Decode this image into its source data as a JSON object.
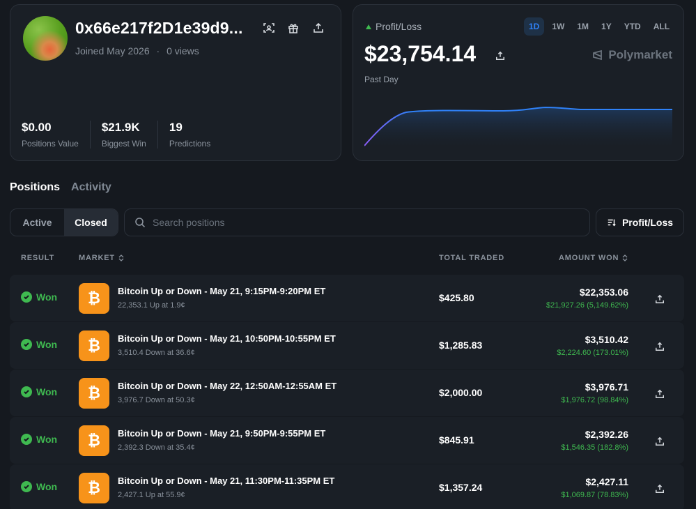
{
  "profile": {
    "address": "0x66e217f2D1e39d9...",
    "joined": "Joined May 2026",
    "separator": "·",
    "views": "0 views",
    "stats": [
      {
        "value": "$0.00",
        "label": "Positions Value"
      },
      {
        "value": "$21.9K",
        "label": "Biggest Win"
      },
      {
        "value": "19",
        "label": "Predictions"
      }
    ]
  },
  "pnl": {
    "label": "Profit/Loss",
    "value": "$23,754.14",
    "period": "Past Day",
    "brand": "Polymarket",
    "ranges": [
      "1D",
      "1W",
      "1M",
      "1Y",
      "YTD",
      "ALL"
    ],
    "active_range": "1D",
    "line_color": "#2f81f7"
  },
  "tabs": {
    "positions": "Positions",
    "activity": "Activity"
  },
  "filter": {
    "active": "Active",
    "closed": "Closed",
    "search_placeholder": "Search positions",
    "sort_label": "Profit/Loss"
  },
  "table": {
    "headers": {
      "result": "RESULT",
      "market": "MARKET",
      "traded": "TOTAL TRADED",
      "won": "AMOUNT WON"
    },
    "rows": [
      {
        "result": "Won",
        "title": "Bitcoin Up or Down - May 21, 9:15PM-9:20PM ET",
        "sub": "22,353.1 Up at 1.9¢",
        "traded": "$425.80",
        "won": "$22,353.06",
        "gain": "$21,927.26 (5,149.62%)"
      },
      {
        "result": "Won",
        "title": "Bitcoin Up or Down - May 21, 10:50PM-10:55PM ET",
        "sub": "3,510.4 Down at 36.6¢",
        "traded": "$1,285.83",
        "won": "$3,510.42",
        "gain": "$2,224.60 (173.01%)"
      },
      {
        "result": "Won",
        "title": "Bitcoin Up or Down - May 22, 12:50AM-12:55AM ET",
        "sub": "3,976.7 Down at 50.3¢",
        "traded": "$2,000.00",
        "won": "$3,976.71",
        "gain": "$1,976.72 (98.84%)"
      },
      {
        "result": "Won",
        "title": "Bitcoin Up or Down - May 21, 9:50PM-9:55PM ET",
        "sub": "2,392.3 Down at 35.4¢",
        "traded": "$845.91",
        "won": "$2,392.26",
        "gain": "$1,546.35 (182.8%)"
      },
      {
        "result": "Won",
        "title": "Bitcoin Up or Down - May 21, 11:30PM-11:35PM ET",
        "sub": "2,427.1 Up at 55.9¢",
        "traded": "$1,357.24",
        "won": "$2,427.11",
        "gain": "$1,069.87 (78.83%)"
      }
    ]
  },
  "colors": {
    "won": "#3fb950",
    "bitcoin": "#f7931a",
    "accent": "#2f81f7"
  }
}
